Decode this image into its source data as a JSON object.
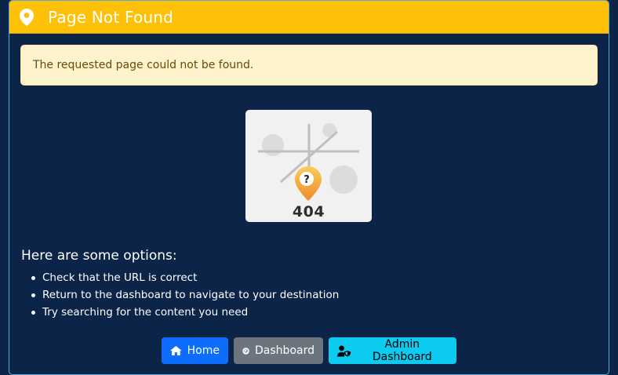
{
  "header": {
    "title": "Page Not Found",
    "icon": "map-pin-icon",
    "color": "#ffc107"
  },
  "alert": {
    "message": "The requested page could not be found."
  },
  "illustration": {
    "code": "404",
    "marker_symbol": "?"
  },
  "options": {
    "heading": "Here are some options:",
    "items": [
      "Check that the URL is correct",
      "Return to the dashboard to navigate to your destination",
      "Try searching for the content you need"
    ]
  },
  "buttons": {
    "home": {
      "label": "Home",
      "icon": "home-icon",
      "color": "#0d6efd"
    },
    "dashboard": {
      "label": "Dashboard",
      "icon": "gauge-icon",
      "color": "#6c757d"
    },
    "admin": {
      "label": "Admin Dashboard",
      "icon": "user-shield-icon",
      "color": "#0dcaf0"
    }
  }
}
